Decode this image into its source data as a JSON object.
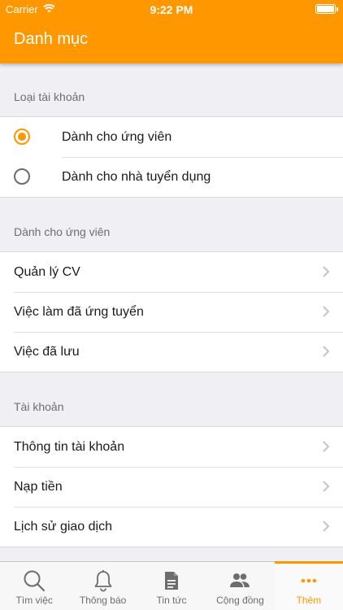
{
  "status_bar": {
    "carrier": "Carrier",
    "time": "9:22 PM"
  },
  "header": {
    "title": "Danh mục"
  },
  "account_type": {
    "header": "Loại tài khoản",
    "options": [
      {
        "label": "Dành cho ứng viên",
        "selected": true
      },
      {
        "label": "Dành cho nhà tuyển dụng",
        "selected": false
      }
    ]
  },
  "candidate": {
    "header": "Dành cho ứng viên",
    "items": [
      {
        "label": "Quản lý CV"
      },
      {
        "label": "Việc làm đã ứng tuyển"
      },
      {
        "label": "Việc đã lưu"
      }
    ]
  },
  "account": {
    "header": "Tài khoản",
    "items": [
      {
        "label": "Thông tin tài khoản"
      },
      {
        "label": "Nạp tiền"
      },
      {
        "label": "Lịch sử giao dịch"
      }
    ]
  },
  "tabs": [
    {
      "label": "Tìm việc",
      "icon": "search-icon"
    },
    {
      "label": "Thông báo",
      "icon": "bell-icon"
    },
    {
      "label": "Tin tức",
      "icon": "document-icon"
    },
    {
      "label": "Cộng đồng",
      "icon": "people-icon"
    },
    {
      "label": "Thêm",
      "icon": "more-icon",
      "active": true
    }
  ],
  "colors": {
    "accent": "#ff9800",
    "background": "#efeff4"
  }
}
